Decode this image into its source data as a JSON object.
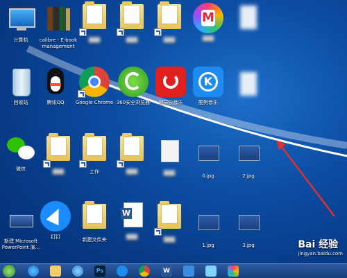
{
  "desktop": {
    "icons": [
      {
        "label": "计算机"
      },
      {
        "label": "calibre - E-book management"
      },
      {
        "label": "回收站"
      },
      {
        "label": "腾讯QQ"
      },
      {
        "label": "Google Chrome"
      },
      {
        "label": "360安全浏览器"
      },
      {
        "label": "网易云音乐"
      },
      {
        "label": "酷狗音乐"
      },
      {
        "label": "微信"
      },
      {
        "label": "工作"
      },
      {
        "label": "0.jpg"
      },
      {
        "label": "2.jpg"
      },
      {
        "label": "新建 Microsoft PowerPoint 演..."
      },
      {
        "label": "钉钉"
      },
      {
        "label": "新建文件夹"
      },
      {
        "label": "1.jpg"
      },
      {
        "label": "3.jpg"
      }
    ]
  },
  "watermark": {
    "brand": "Bai 经验",
    "url": "jingyan.baidu.com"
  },
  "colors": {
    "desktop": "#0d4fa6",
    "arrow": "#e0312f",
    "taskbar": "#173e7c"
  }
}
